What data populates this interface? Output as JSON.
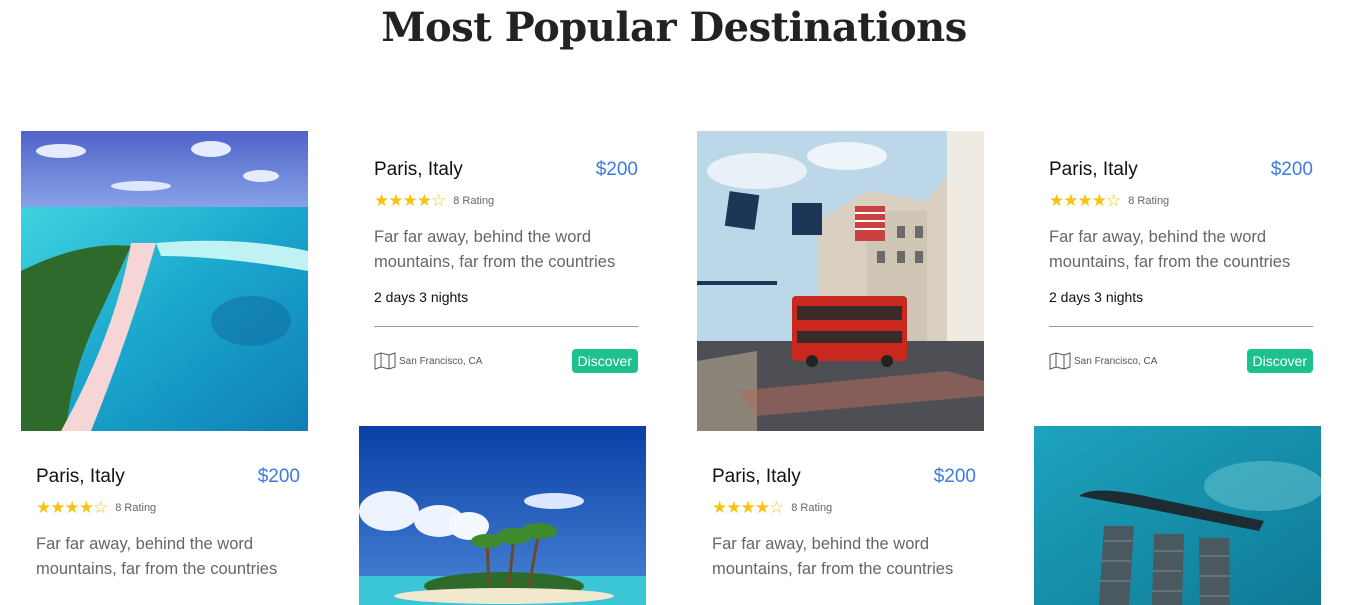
{
  "section": {
    "title": "Most Popular Destinations"
  },
  "cards": [
    {
      "place": "Paris, Italy",
      "price": "$200",
      "rating_label": "8 Rating",
      "stars": 4,
      "description": "Far far away, behind the word mountains, far from the countries"
    },
    {
      "place": "Paris, Italy",
      "price": "$200",
      "rating_label": "8 Rating",
      "stars": 4,
      "description": "Far far away, behind the word mountains, far from the countries",
      "duration": "2 days 3 nights",
      "location": "San Francisco, CA",
      "button": "Discover"
    },
    {
      "place": "Paris, Italy",
      "price": "$200",
      "rating_label": "8 Rating",
      "stars": 4,
      "description": "Far far away, behind the word mountains, far from the countries"
    },
    {
      "place": "Paris, Italy",
      "price": "$200",
      "rating_label": "8 Rating",
      "stars": 4,
      "description": "Far far away, behind the word mountains, far from the countries",
      "duration": "2 days 3 nights",
      "location": "San Francisco, CA",
      "button": "Discover"
    }
  ],
  "colors": {
    "price": "#3d7be0",
    "star": "#f6c313",
    "button": "#1dc08f",
    "title": "#222222"
  },
  "icons": {
    "star": "star-icon",
    "map": "map-icon"
  }
}
